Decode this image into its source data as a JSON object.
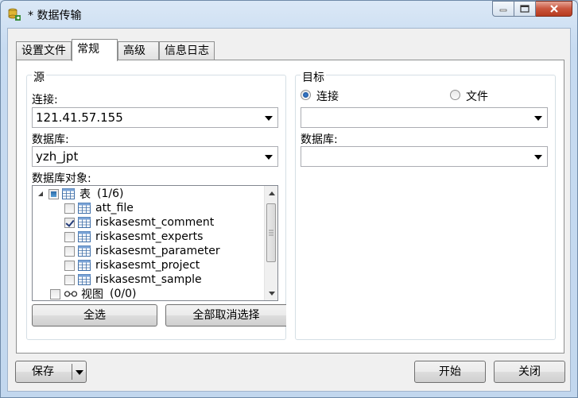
{
  "window": {
    "title": "* 数据传输"
  },
  "tabs": [
    {
      "label": "设置文件",
      "active": false
    },
    {
      "label": "常规",
      "active": true
    },
    {
      "label": "高级",
      "active": false
    },
    {
      "label": "信息日志",
      "active": false
    }
  ],
  "source": {
    "legend": "源",
    "connection_label": "连接:",
    "connection_value": "121.41.57.155",
    "database_label": "数据库:",
    "database_value": "yzh_jpt",
    "objects_label": "数据库对象:",
    "tree": {
      "tables_label": "表",
      "tables_count": "(1/6)",
      "tables": [
        {
          "name": "att_file",
          "checked": false
        },
        {
          "name": "riskasesmt_comment",
          "checked": true
        },
        {
          "name": "riskasesmt_experts",
          "checked": false
        },
        {
          "name": "riskasesmt_parameter",
          "checked": false
        },
        {
          "name": "riskasesmt_project",
          "checked": false
        },
        {
          "name": "riskasesmt_sample",
          "checked": false
        }
      ],
      "views_label": "视图",
      "views_count": "(0/0)"
    },
    "select_all_label": "全选",
    "deselect_all_label": "全部取消选择"
  },
  "target": {
    "legend": "目标",
    "radio_connection_label": "连接",
    "radio_file_label": "文件",
    "selected_mode": "连接",
    "connection_value": "",
    "database_label": "数据库:",
    "database_value": ""
  },
  "footer": {
    "save_label": "保存",
    "start_label": "开始",
    "close_label": "关闭"
  },
  "colors": {
    "title_bar": "#c7dbf1",
    "close_button": "#c9553d",
    "accent": "#2b6aa8"
  }
}
